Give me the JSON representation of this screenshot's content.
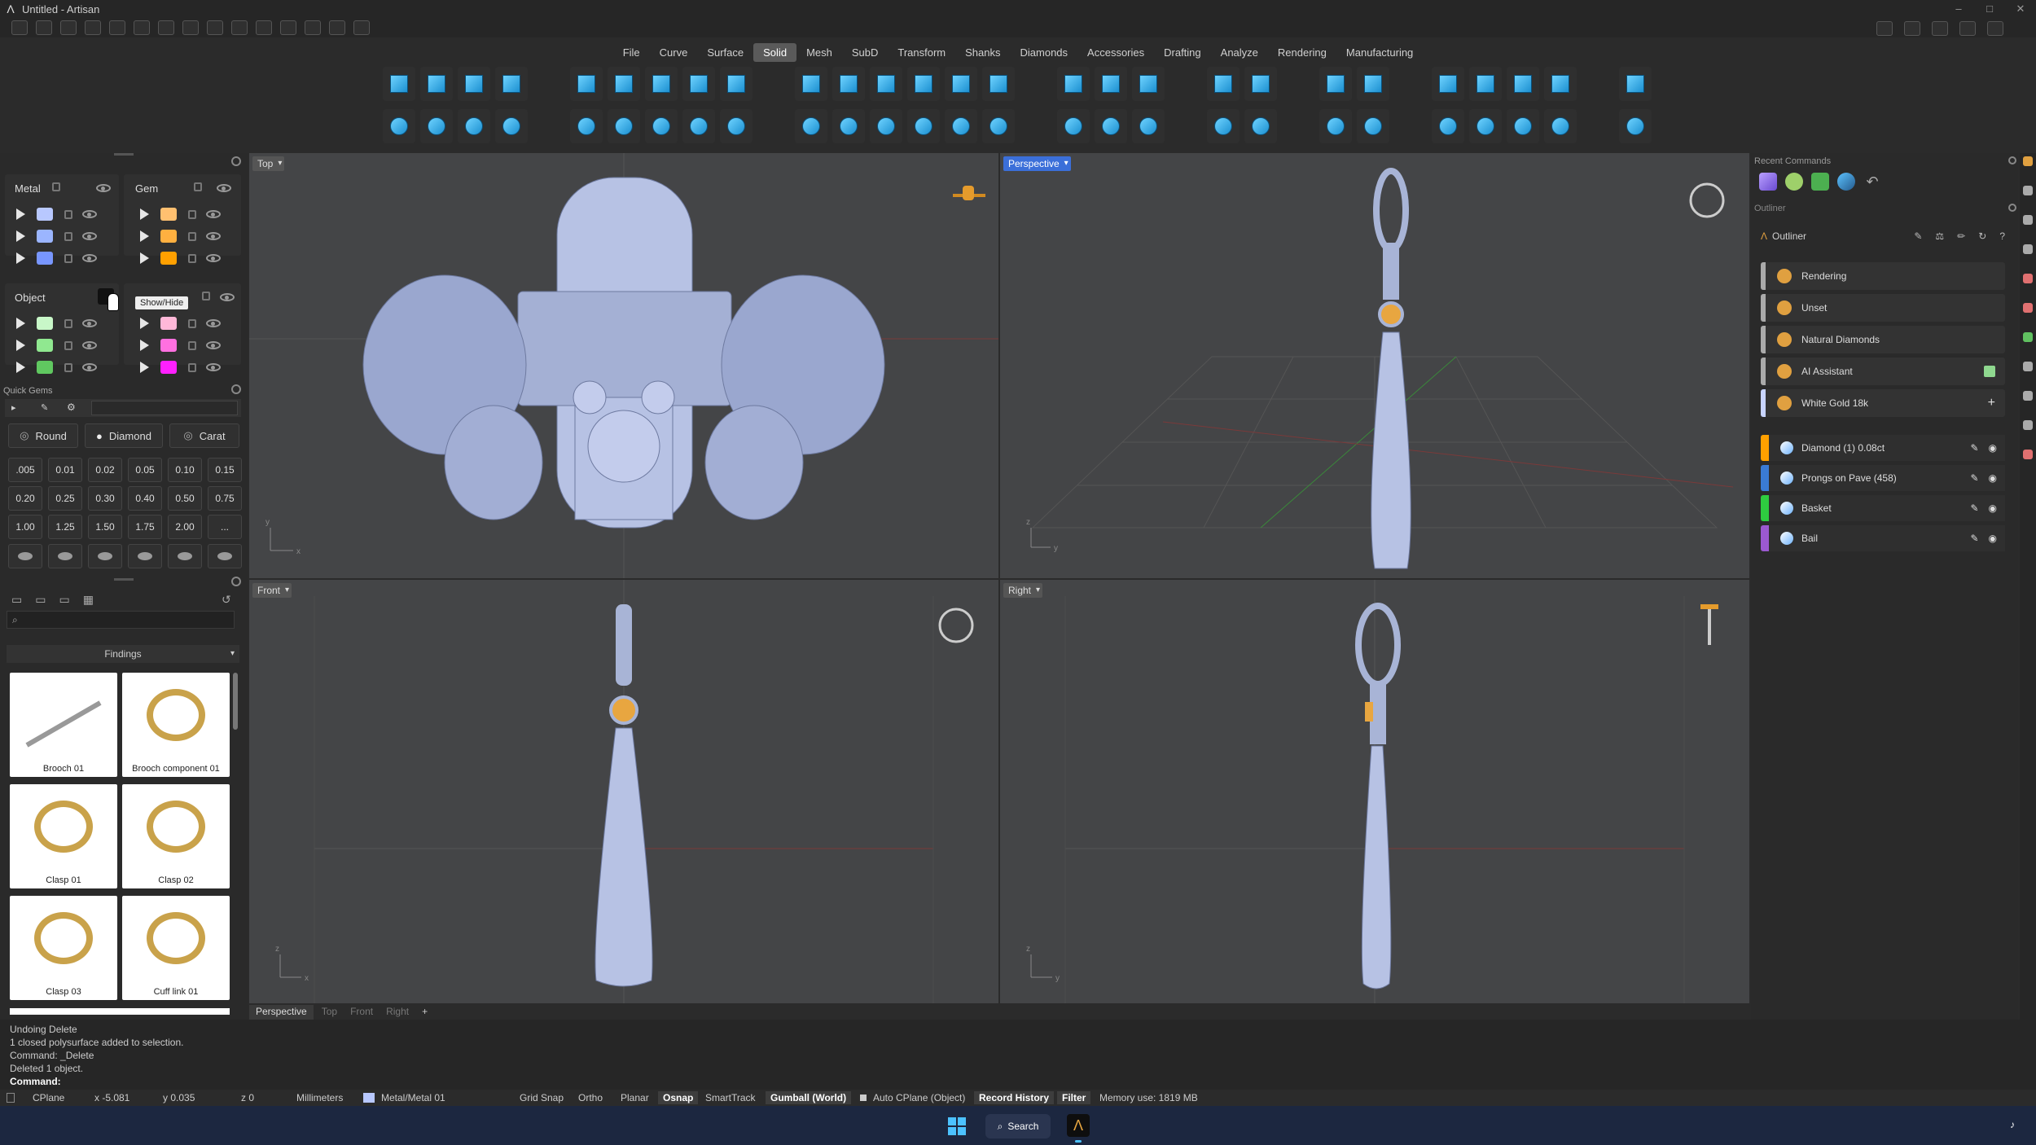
{
  "window": {
    "title": "Untitled - Artisan"
  },
  "menu": {
    "items": [
      "File",
      "Curve",
      "Surface",
      "Solid",
      "Mesh",
      "SubD",
      "Transform",
      "Shanks",
      "Diamonds",
      "Accessories",
      "Drafting",
      "Analyze",
      "Rendering",
      "Manufacturing"
    ],
    "active": "Solid"
  },
  "layers": {
    "metal": {
      "title": "Metal",
      "swatches": [
        "#b8c8ff",
        "#9bb5ff",
        "#7896ff"
      ]
    },
    "gem": {
      "title": "Gem",
      "swatches": [
        "#ffc070",
        "#ffb040",
        "#ffa000"
      ]
    },
    "object": {
      "title": "Object",
      "swatches": [
        "#c8f7c8",
        "#90e890",
        "#60c860"
      ]
    },
    "other": {
      "swatches": [
        "#ffb8d8",
        "#ff70e0",
        "#ff20ff"
      ]
    },
    "tooltip": "Show/Hide"
  },
  "quick_gems": {
    "title": "Quick Gems",
    "shape_buttons": [
      "Round",
      "Diamond",
      "Carat"
    ],
    "sizes": [
      ".005",
      "0.01",
      "0.02",
      "0.05",
      "0.10",
      "0.15",
      "0.20",
      "0.25",
      "0.30",
      "0.40",
      "0.50",
      "0.75",
      "1.00",
      "1.25",
      "1.50",
      "1.75",
      "2.00",
      "..."
    ]
  },
  "library": {
    "category": "Findings",
    "items": [
      "Brooch 01",
      "Brooch component 01",
      "Clasp 01",
      "Clasp 02",
      "Clasp 03",
      "Cuff link 01"
    ]
  },
  "viewports": {
    "top": "Top",
    "perspective": "Perspective",
    "front": "Front",
    "right": "Right",
    "tabs": [
      "Perspective",
      "Top",
      "Front",
      "Right",
      "+"
    ]
  },
  "right_panel": {
    "recent_commands": "Recent Commands",
    "outliner_header": "Outliner",
    "outliner_tab": "Outliner",
    "categories": [
      {
        "label": "Rendering",
        "color": "#aaa"
      },
      {
        "label": "Unset",
        "color": "#aaa"
      },
      {
        "label": "Natural Diamonds",
        "color": "#aaa"
      },
      {
        "label": "AI Assistant",
        "color": "#aaa"
      },
      {
        "label": "White Gold 18k",
        "color": "#c8d4ff"
      }
    ],
    "objects": [
      {
        "label": "Diamond (1) 0.08ct",
        "color": "#ffa000"
      },
      {
        "label": "Prongs on Pave (458)",
        "color": "#3a7bd5"
      },
      {
        "label": "Basket",
        "color": "#2ecc40"
      },
      {
        "label": "Bail",
        "color": "#9b59d0"
      }
    ]
  },
  "command": {
    "history": [
      "Undoing Delete",
      "1 closed polysurface added to selection.",
      "Command: _Delete",
      "Deleted 1 object."
    ],
    "prompt": "Command:"
  },
  "status": {
    "cplane": "CPlane",
    "x": "x -5.081",
    "y": "y 0.035",
    "z": "z 0",
    "units": "Millimeters",
    "layer": "Metal/Metal 01",
    "grid_snap": "Grid Snap",
    "ortho": "Ortho",
    "planar": "Planar",
    "osnap": "Osnap",
    "smarttrack": "SmartTrack",
    "gumball": "Gumball (World)",
    "auto_cplane": "Auto CPlane (Object)",
    "record_history": "Record History",
    "filter": "Filter",
    "memory": "Memory use: 1819 MB"
  },
  "taskbar": {
    "search": "Search"
  }
}
